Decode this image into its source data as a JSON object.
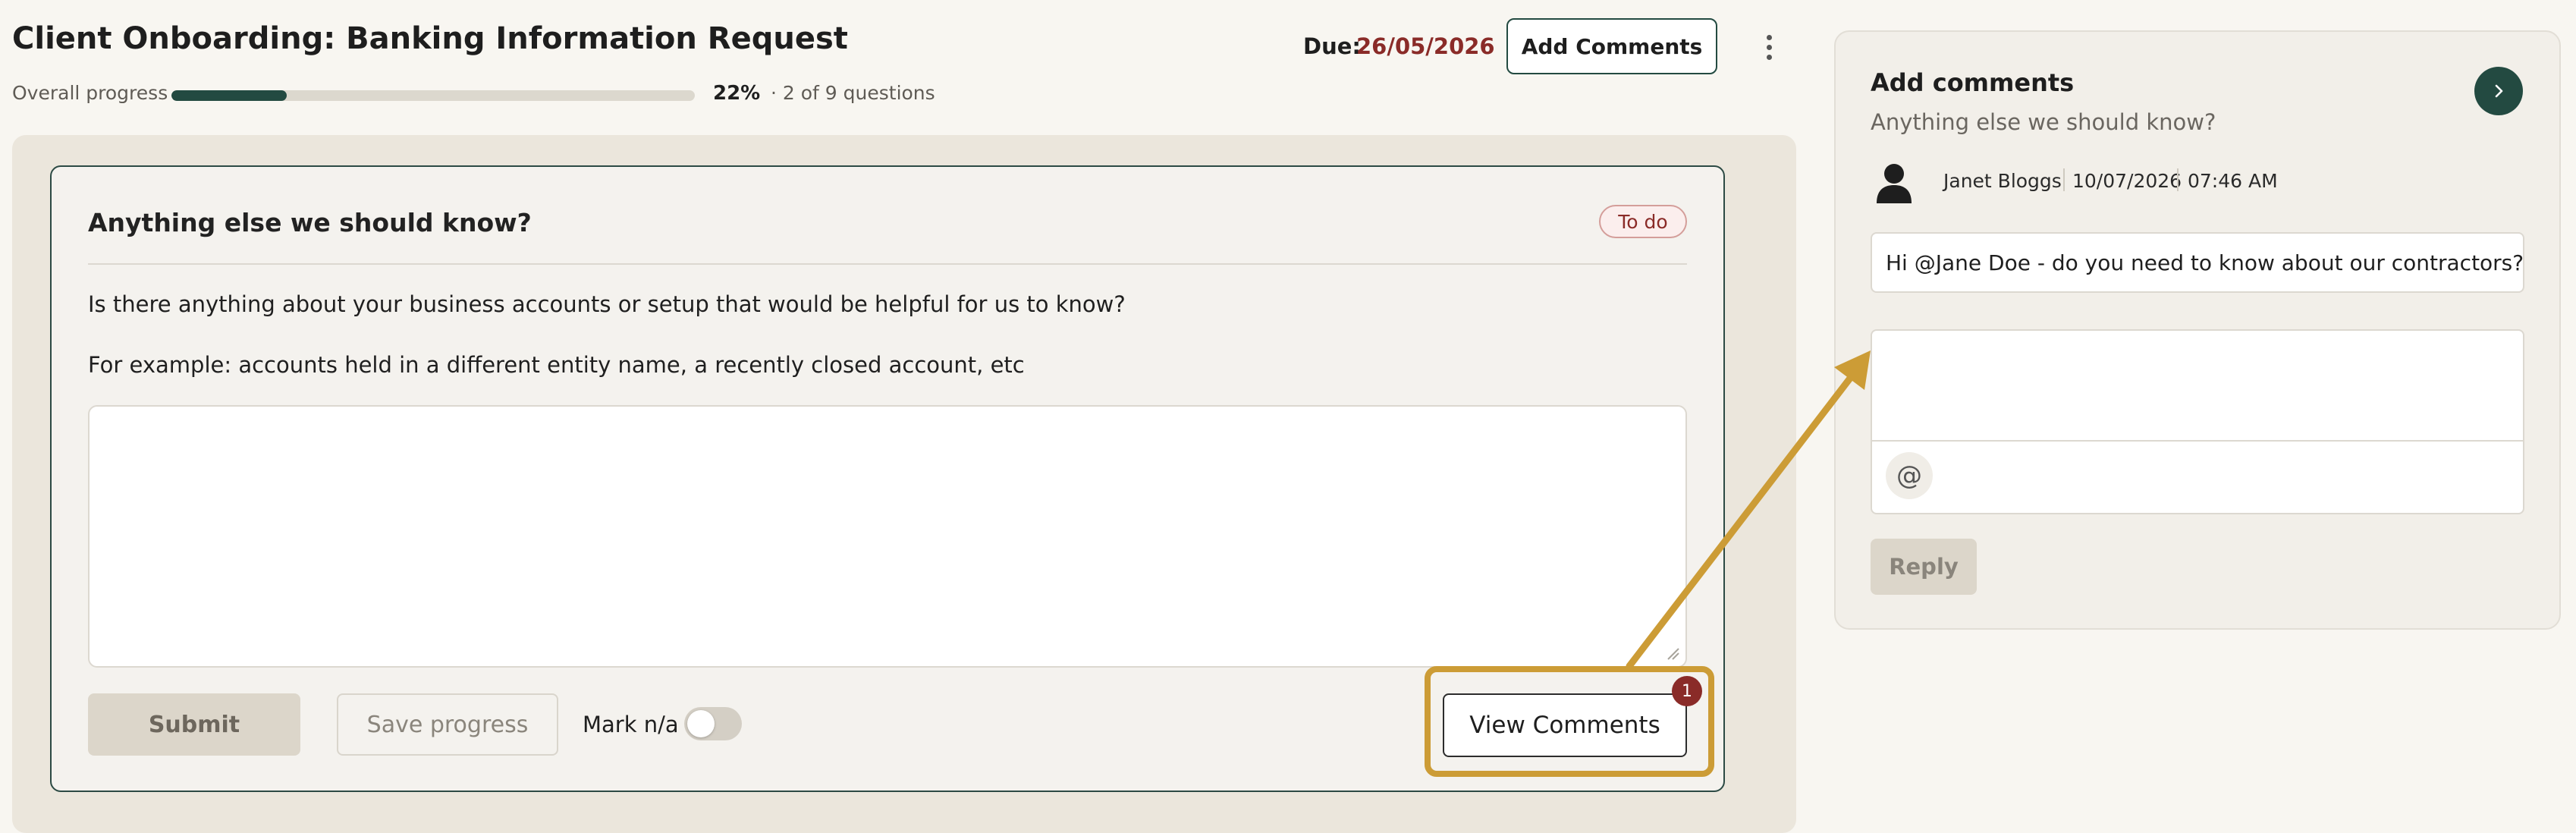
{
  "header": {
    "title": "Client Onboarding: Banking Information Request",
    "progress_label": "Overall progress",
    "progress_value": 0.22,
    "progress_percent": "22%",
    "progress_count": "· 2 of 9 questions",
    "due_label": "Due:",
    "due_date": "26/05/2026",
    "add_comments_label": "Add Comments",
    "more_icon": "more-vertical-icon"
  },
  "question": {
    "title": "Anything else we should know?",
    "status": "To do",
    "body_line1": "Is there anything about your business accounts or setup that would be helpful for us to know?",
    "body_line2": "For example: accounts held in a different entity name, a recently closed account, etc",
    "answer_value": "",
    "submit_label": "Submit",
    "save_label": "Save progress",
    "mark_na_label": "Mark n/a",
    "mark_na_on": false,
    "view_comments_label": "View Comments",
    "comment_count": "1"
  },
  "comments_panel": {
    "title": "Add comments",
    "subtitle": "Anything else we should know?",
    "comments": [
      {
        "author": "Janet Bloggs",
        "date": "10/07/2026",
        "time": "07:46 AM",
        "text": "Hi @Jane Doe - do you need to know about our contractors?"
      }
    ],
    "reply_value": "",
    "mention_symbol": "@",
    "reply_label": "Reply"
  },
  "colors": {
    "accent": "#234a41",
    "due": "#8a2b28",
    "highlight": "#cc9c36",
    "badge": "#8a2b28"
  }
}
